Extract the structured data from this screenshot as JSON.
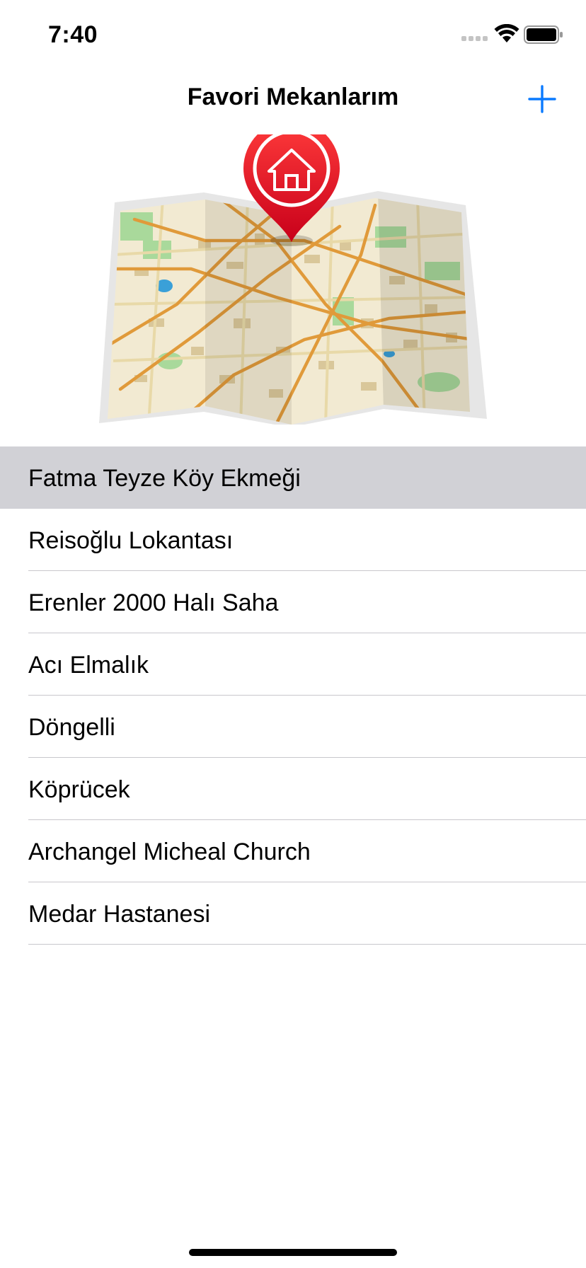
{
  "status_bar": {
    "time": "7:40"
  },
  "nav": {
    "title": "Favori Mekanlarım",
    "add_icon": "plus-icon",
    "accent_color": "#0a7aff"
  },
  "hero": {
    "icon": "map-with-home-pin",
    "pin_color": "#e3001b"
  },
  "places": [
    {
      "label": "Fatma Teyze Köy Ekmeği",
      "selected": true
    },
    {
      "label": "Reisoğlu Lokantası",
      "selected": false
    },
    {
      "label": "Erenler 2000 Halı Saha",
      "selected": false
    },
    {
      "label": "Acı Elmalık",
      "selected": false
    },
    {
      "label": "Döngelli",
      "selected": false
    },
    {
      "label": "Köprücek",
      "selected": false
    },
    {
      "label": "Archangel Micheal Church",
      "selected": false
    },
    {
      "label": "Medar Hastanesi",
      "selected": false
    }
  ]
}
